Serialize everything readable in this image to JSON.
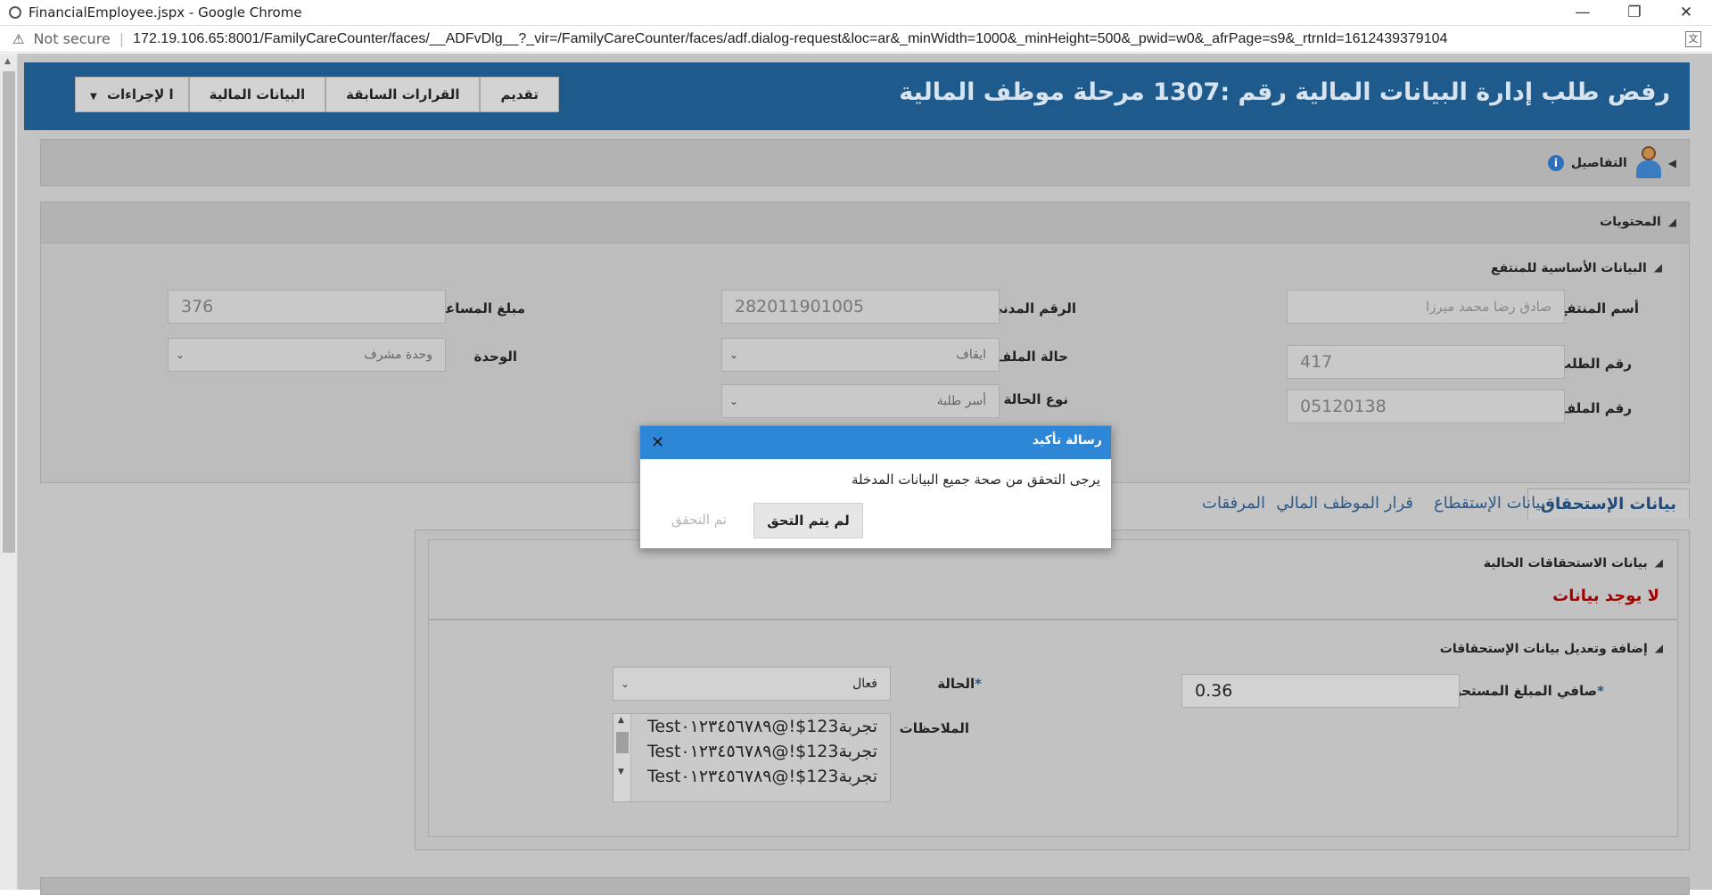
{
  "browser": {
    "tab_title": "FinancialEmployee.jspx - Google Chrome",
    "security": "Not secure",
    "url": "172.19.106.65:8001/FamilyCareCounter/faces/__ADFvDlg__?_vir=/FamilyCareCounter/faces/adf.dialog-request&loc=ar&_minWidth=1000&_minHeight=500&_pwid=w0&_afrPage=s9&_rtrnId=1612439379104"
  },
  "header": {
    "title": "رفض طلب إدارة البيانات المالية رقم :1307 مرحلة موظف المالية",
    "buttons": {
      "submit": "تقديم",
      "previous_decisions": "القرارات السابقة",
      "financial_data": "البيانات المالية",
      "actions": "ا لإجراءات"
    }
  },
  "details": {
    "label": "التفاصيل"
  },
  "contents": {
    "label": "المحتويات",
    "basic_data_label": "البيانات الأساسية للمنتفع",
    "fields": {
      "beneficiary_name": {
        "label": "أسم المنتفع",
        "value": "صادق رضا محمد ميرزا"
      },
      "civil_id": {
        "label": "الرقم المدني",
        "value": "282011901005"
      },
      "aid_amount": {
        "label": "مبلغ المساعدة",
        "value": "376"
      },
      "request_no": {
        "label": "رقم الطلب",
        "value": "417"
      },
      "file_status": {
        "label": "حالة الملف",
        "value": "ايقاف"
      },
      "unit": {
        "label": "الوحدة",
        "value": "وحدة مشرف"
      },
      "file_no": {
        "label": "رقم الملف",
        "value": "05120138"
      },
      "case_type": {
        "label": "نوع الحالة",
        "value": "أسر طلبة"
      }
    }
  },
  "tabs": [
    {
      "label": "بيانات الإستحقاق",
      "active": true
    },
    {
      "label": "بيانات الإستقطاع"
    },
    {
      "label": "قرار الموظف المالي"
    },
    {
      "label": "المرفقات"
    }
  ],
  "entitlements": {
    "current_label": "بيانات الاستحقاقات الحالية",
    "no_data": "لا يوجد بيانات",
    "add_edit_label": "إضافة وتعديل بيانات الإستحقاقات",
    "net_amount": {
      "label": "صافي المبلغ المستحق",
      "value": "0.36"
    },
    "status": {
      "label": "الحالة",
      "value": "فعال"
    },
    "notes": {
      "label": "الملاحظات",
      "lines": [
        "Testتجربة123$!@٠١٢٣٤٥٦٧٨٩",
        "Testتجربة123$!@٠١٢٣٤٥٦٧٨٩",
        "Testتجربة123$!@٠١٢٣٤٥٦٧٨٩"
      ]
    }
  },
  "dialog": {
    "title": "رسالة تأكيد",
    "message": "يرجى التحقق من صحة جميع البيانات المدخلة",
    "verify_button": "لم يتم التحق",
    "done_button": "تم التحقق"
  },
  "colors": {
    "header_blue": "#1f5a8c",
    "dialog_blue": "#2e86d6",
    "no_data_red": "#a50000"
  }
}
